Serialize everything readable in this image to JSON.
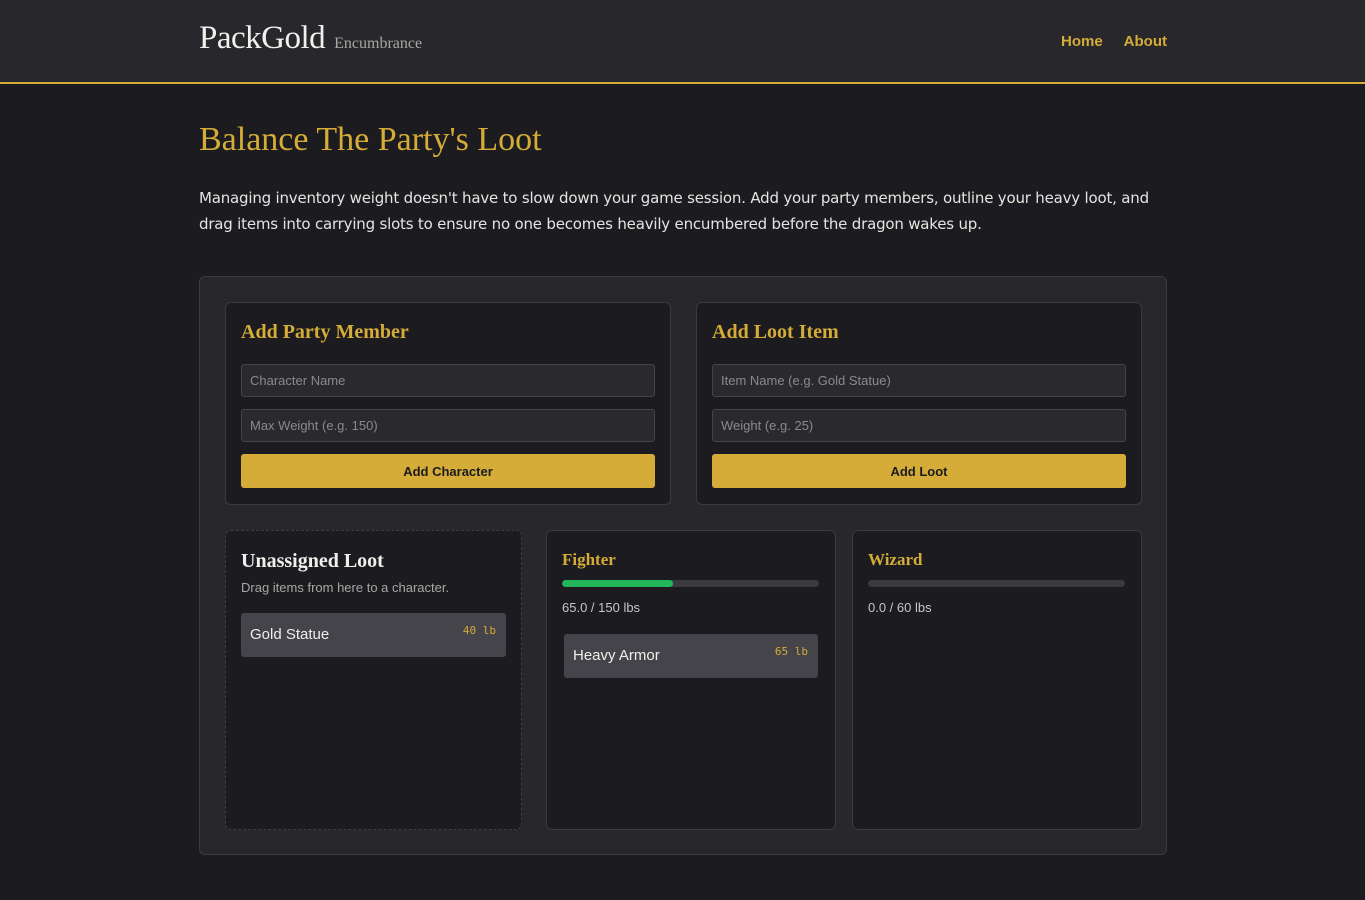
{
  "header": {
    "brand": "PackGold",
    "tagline": "Encumbrance",
    "nav": [
      {
        "label": "Home"
      },
      {
        "label": "About"
      }
    ]
  },
  "hero": {
    "title": "Balance The Party's Loot",
    "description": "Managing inventory weight doesn't have to slow down your game session. Add your party members, outline your heavy loot, and drag items into carrying slots to ensure no one becomes heavily encumbered before the dragon wakes up."
  },
  "add_member": {
    "title": "Add Party Member",
    "name_placeholder": "Character Name",
    "weight_placeholder": "Max Weight (e.g. 150)",
    "name_value": "",
    "weight_value": "",
    "button_label": "Add Character"
  },
  "add_loot": {
    "title": "Add Loot Item",
    "name_placeholder": "Item Name (e.g. Gold Statue)",
    "weight_placeholder": "Weight (e.g. 25)",
    "name_value": "",
    "weight_value": "",
    "button_label": "Add Loot"
  },
  "unassigned": {
    "title": "Unassigned Loot",
    "hint": "Drag items from here to a character.",
    "items": [
      {
        "name": "Gold Statue",
        "weight": "40 lb"
      }
    ]
  },
  "characters": [
    {
      "name": "Fighter",
      "weight_text": "65.0 / 150 lbs",
      "load_fraction": 0.433,
      "bar_color": "#22b55a",
      "items": [
        {
          "name": "Heavy Armor",
          "weight": "65 lb"
        }
      ]
    },
    {
      "name": "Wizard",
      "weight_text": "0.0 / 60 lbs",
      "load_fraction": 0.0,
      "bar_color": "#22b55a",
      "items": []
    }
  ],
  "colors": {
    "accent": "#d4ac37",
    "background": "#1c1b1f",
    "surface": "#28272c",
    "load_ok": "#22b55a"
  }
}
